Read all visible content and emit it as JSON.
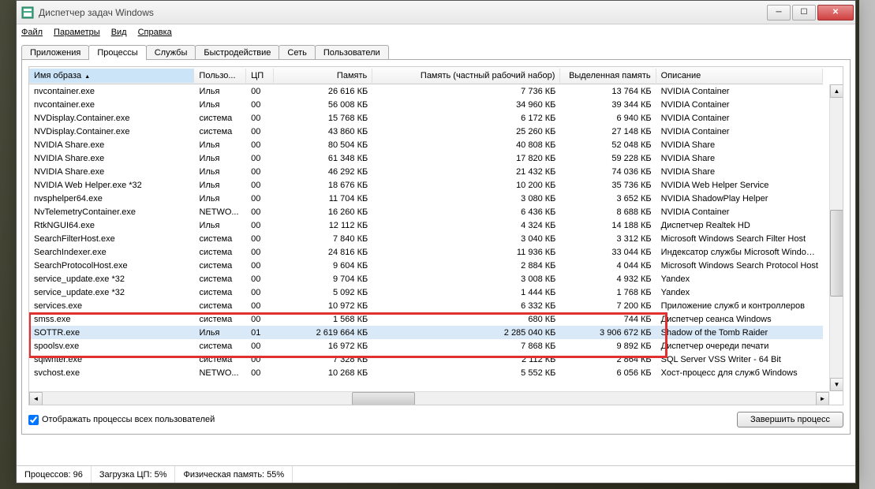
{
  "window": {
    "title": "Диспетчер задач Windows"
  },
  "menu": [
    "Файл",
    "Параметры",
    "Вид",
    "Справка"
  ],
  "tabs": [
    "Приложения",
    "Процессы",
    "Службы",
    "Быстродействие",
    "Сеть",
    "Пользователи"
  ],
  "active_tab": 1,
  "columns": [
    "Имя образа",
    "Пользо...",
    "ЦП",
    "Память",
    "Память (частный рабочий набор)",
    "Выделенная память",
    "Описание"
  ],
  "sort_col": 0,
  "rows": [
    {
      "n": "nvcontainer.exe",
      "u": "Илья",
      "c": "00",
      "m": "26 616 КБ",
      "p": "7 736 КБ",
      "a": "13 764 КБ",
      "d": "NVIDIA Container"
    },
    {
      "n": "nvcontainer.exe",
      "u": "Илья",
      "c": "00",
      "m": "56 008 КБ",
      "p": "34 960 КБ",
      "a": "39 344 КБ",
      "d": "NVIDIA Container"
    },
    {
      "n": "NVDisplay.Container.exe",
      "u": "система",
      "c": "00",
      "m": "15 768 КБ",
      "p": "6 172 КБ",
      "a": "6 940 КБ",
      "d": "NVIDIA Container"
    },
    {
      "n": "NVDisplay.Container.exe",
      "u": "система",
      "c": "00",
      "m": "43 860 КБ",
      "p": "25 260 КБ",
      "a": "27 148 КБ",
      "d": "NVIDIA Container"
    },
    {
      "n": "NVIDIA Share.exe",
      "u": "Илья",
      "c": "00",
      "m": "80 504 КБ",
      "p": "40 808 КБ",
      "a": "52 048 КБ",
      "d": "NVIDIA Share"
    },
    {
      "n": "NVIDIA Share.exe",
      "u": "Илья",
      "c": "00",
      "m": "61 348 КБ",
      "p": "17 820 КБ",
      "a": "59 228 КБ",
      "d": "NVIDIA Share"
    },
    {
      "n": "NVIDIA Share.exe",
      "u": "Илья",
      "c": "00",
      "m": "46 292 КБ",
      "p": "21 432 КБ",
      "a": "74 036 КБ",
      "d": "NVIDIA Share"
    },
    {
      "n": "NVIDIA Web Helper.exe *32",
      "u": "Илья",
      "c": "00",
      "m": "18 676 КБ",
      "p": "10 200 КБ",
      "a": "35 736 КБ",
      "d": "NVIDIA Web Helper Service"
    },
    {
      "n": "nvsphelper64.exe",
      "u": "Илья",
      "c": "00",
      "m": "11 704 КБ",
      "p": "3 080 КБ",
      "a": "3 652 КБ",
      "d": "NVIDIA ShadowPlay Helper"
    },
    {
      "n": "NvTelemetryContainer.exe",
      "u": "NETWO...",
      "c": "00",
      "m": "16 260 КБ",
      "p": "6 436 КБ",
      "a": "8 688 КБ",
      "d": "NVIDIA Container"
    },
    {
      "n": "RtkNGUI64.exe",
      "u": "Илья",
      "c": "00",
      "m": "12 112 КБ",
      "p": "4 324 КБ",
      "a": "14 188 КБ",
      "d": "Диспетчер Realtek HD"
    },
    {
      "n": "SearchFilterHost.exe",
      "u": "система",
      "c": "00",
      "m": "7 840 КБ",
      "p": "3 040 КБ",
      "a": "3 312 КБ",
      "d": "Microsoft Windows Search Filter Host"
    },
    {
      "n": "SearchIndexer.exe",
      "u": "система",
      "c": "00",
      "m": "24 816 КБ",
      "p": "11 936 КБ",
      "a": "33 044 КБ",
      "d": "Индексатор службы Microsoft Windows Sea"
    },
    {
      "n": "SearchProtocolHost.exe",
      "u": "система",
      "c": "00",
      "m": "9 604 КБ",
      "p": "2 884 КБ",
      "a": "4 044 КБ",
      "d": "Microsoft Windows Search Protocol Host"
    },
    {
      "n": "service_update.exe *32",
      "u": "система",
      "c": "00",
      "m": "9 704 КБ",
      "p": "3 008 КБ",
      "a": "4 932 КБ",
      "d": "Yandex"
    },
    {
      "n": "service_update.exe *32",
      "u": "система",
      "c": "00",
      "m": "5 092 КБ",
      "p": "1 444 КБ",
      "a": "1 768 КБ",
      "d": "Yandex"
    },
    {
      "n": "services.exe",
      "u": "система",
      "c": "00",
      "m": "10 972 КБ",
      "p": "6 332 КБ",
      "a": "7 200 КБ",
      "d": "Приложение служб и контроллеров"
    },
    {
      "n": "smss.exe",
      "u": "система",
      "c": "00",
      "m": "1 568 КБ",
      "p": "680 КБ",
      "a": "744 КБ",
      "d": "Диспетчер сеанса  Windows"
    },
    {
      "n": "SOTTR.exe",
      "u": "Илья",
      "c": "01",
      "m": "2 619 664 КБ",
      "p": "2 285 040 КБ",
      "a": "3 906 672 КБ",
      "d": "Shadow of the Tomb Raider",
      "sel": true
    },
    {
      "n": "spoolsv.exe",
      "u": "система",
      "c": "00",
      "m": "16 972 КБ",
      "p": "7 868 КБ",
      "a": "9 892 КБ",
      "d": "Диспетчер очереди печати"
    },
    {
      "n": "sqlwriter.exe",
      "u": "система",
      "c": "00",
      "m": "7 328 КБ",
      "p": "2 112 КБ",
      "a": "2 864 КБ",
      "d": "SQL Server VSS Writer - 64 Bit"
    },
    {
      "n": "svchost.exe",
      "u": "NETWO...",
      "c": "00",
      "m": "10 268 КБ",
      "p": "5 552 КБ",
      "a": "6 056 КБ",
      "d": "Хост-процесс для служб Windows"
    }
  ],
  "checkbox": {
    "label": "Отображать процессы всех пользователей",
    "checked": true
  },
  "end_process": "Завершить процесс",
  "status": {
    "processes": "Процессов: 96",
    "cpu": "Загрузка ЦП: 5%",
    "mem": "Физическая память: 55%"
  }
}
